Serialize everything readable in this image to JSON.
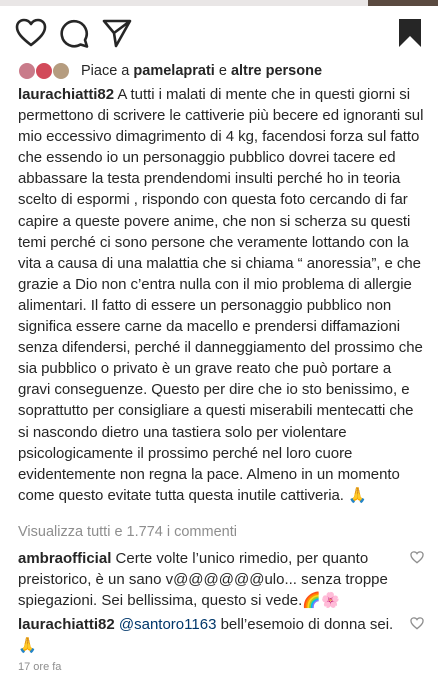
{
  "likes": {
    "prefix": "Piace a",
    "user": "pamelaprati",
    "joiner": "e",
    "others": "altre persone"
  },
  "caption": {
    "username": "laurachiatti82",
    "text": "A tutti i malati di mente che in questi giorni si permettono di scrivere le cattiverie più becere ed ignoranti sul mio eccessivo dimagrimento di 4 kg, facendosi forza sul fatto che essendo io un personaggio pubblico dovrei tacere ed abbassare la testa  prendendomi insulti perché ho in teoria scelto di espormi , rispondo con questa foto cercando di far capire a queste povere anime, che non si scherza su questi temi perché ci sono persone che veramente lottando con la vita a causa di una malattia che si chiama “ anoressia”, e che grazie a Dio  non c’entra nulla con il mio problema di allergie alimentari. Il fatto di essere un personaggio pubblico non significa essere carne da macello e prendersi diffamazioni senza difendersi, perché il danneggiamento del prossimo che sia pubblico o privato è un grave reato che può portare a gravi conseguenze. Questo per dire che io sto benissimo, e soprattutto per consigliare a questi miserabili  mentecatti che si nascondo dietro una tastiera solo per violentare psicologicamente il prossimo perché nel loro cuore evidentemente non regna la pace. Almeno in un momento come questo evitate  tutta questa inutile cattiveria.",
    "emoji": "🙏"
  },
  "view_all_comments": "Visualizza tutti e 1.774 i commenti",
  "comments": [
    {
      "username": "ambraofficial",
      "text": "Certe volte l’unico rimedio, per quanto preistorico, è un sano v@@@@@@ulo... senza troppe spiegazioni. Sei bellissima, questo si vede.",
      "emoji_1": "🌈",
      "emoji_2": "🌸"
    },
    {
      "username": "laurachiatti82",
      "mention": "@santoro1163",
      "text": "bell’esemoio di donna sei.",
      "emoji": "🙏"
    }
  ],
  "timestamp": "17 ore fa",
  "icons": [
    "heart-icon",
    "comment-icon",
    "share-icon",
    "bookmark-icon"
  ],
  "colors": {
    "link": "#00376b",
    "muted": "#8e8e8e",
    "text": "#262626"
  }
}
